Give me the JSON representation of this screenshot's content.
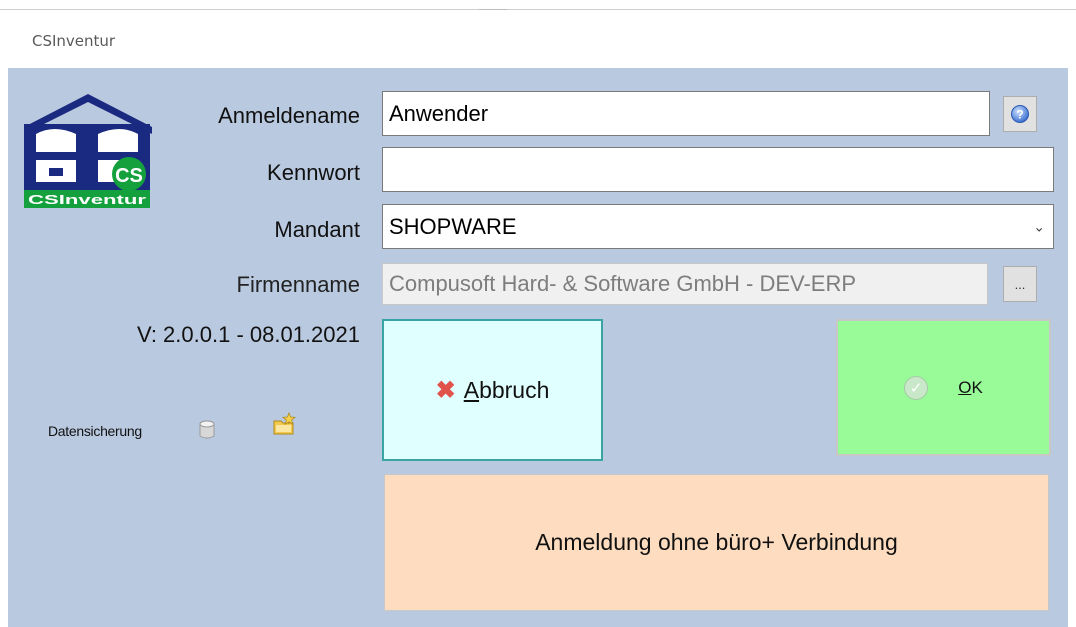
{
  "window": {
    "title": "CSInventur"
  },
  "logo": {
    "text": "CSInventur",
    "badge": "CS"
  },
  "form": {
    "username": {
      "label": "Anmeldename",
      "value": "Anwender"
    },
    "password": {
      "label": "Kennwort",
      "value": ""
    },
    "client": {
      "label": "Mandant",
      "selected": "SHOPWARE"
    },
    "company": {
      "label": "Firmenname",
      "value": "Compusoft Hard- & Software GmbH - DEV-ERP"
    },
    "help_icon": "help-icon",
    "browse_label": "..."
  },
  "version": "V: 2.0.0.1 - 08.01.2021",
  "backup": {
    "label": "Datensicherung",
    "icons": [
      "database-icon",
      "folder-star-icon"
    ]
  },
  "buttons": {
    "cancel": {
      "accel": "A",
      "rest": "bbruch",
      "icon": "cross-icon"
    },
    "ok": {
      "accel": "O",
      "rest": "K",
      "icon": "check-icon"
    },
    "offline": {
      "label": "Anmeldung ohne büro+ Verbindung"
    }
  },
  "colors": {
    "panel": "#b9c9e0",
    "cancel_bg": "#e0ffff",
    "cancel_border": "#3aa3a3",
    "ok_bg": "#98fb98",
    "offline_bg": "#fddcbf",
    "logo_blue": "#1a2a80",
    "logo_green": "#14a03c"
  }
}
